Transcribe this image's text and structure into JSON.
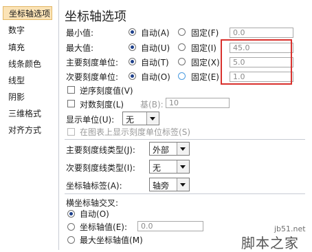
{
  "sidebar": {
    "items": [
      {
        "label": "坐标轴选项",
        "active": true
      },
      {
        "label": "数字"
      },
      {
        "label": "填充"
      },
      {
        "label": "线条颜色"
      },
      {
        "label": "线型"
      },
      {
        "label": "阴影"
      },
      {
        "label": "三维格式"
      },
      {
        "label": "对齐方式"
      }
    ]
  },
  "panel": {
    "title": "坐标轴选项",
    "auto_label": "自动",
    "fixed_label": "固定",
    "rows": [
      {
        "label": "最小值:",
        "auto_key": "A",
        "fixed_key": "F",
        "value": "0.0"
      },
      {
        "label": "最大值:",
        "auto_key": "U",
        "fixed_key": "I",
        "value": "45.0"
      },
      {
        "label": "主要刻度单位:",
        "auto_key": "T",
        "fixed_key": "X",
        "value": "5.0"
      },
      {
        "label": "次要刻度单位:",
        "auto_key": "O",
        "fixed_key": "E",
        "value": "1.0"
      }
    ],
    "reverse_order": "逆序刻度值",
    "reverse_key": "V",
    "log_scale": "对数刻度",
    "log_key": "L",
    "base_label": "基",
    "base_key": "B",
    "base_value": "10",
    "display_units_label": "显示单位",
    "display_units_key": "U",
    "display_units_value": "无",
    "show_units_label": "在图表上显示刻度单位标签",
    "show_units_key": "S",
    "major_tick_label": "主要刻度线类型",
    "major_tick_key": "J",
    "major_tick_value": "外部",
    "minor_tick_label": "次要刻度线类型",
    "minor_tick_key": "I",
    "minor_tick_value": "无",
    "axis_labels_label": "坐标轴标签",
    "axis_labels_key": "A",
    "axis_labels_value": "轴旁",
    "crosses_title": "横坐标轴交叉:",
    "crosses_auto": "自动",
    "crosses_auto_key": "O",
    "crosses_value_label": "坐标轴值",
    "crosses_value_key": "E",
    "crosses_value": "0.0",
    "crosses_max": "最大坐标轴值",
    "crosses_max_key": "M"
  },
  "watermark": {
    "site": "jb51.net",
    "brand": "脚本之家"
  },
  "colors": {
    "highlight_box": "#d9302c",
    "active_tab": "#fbe3b6"
  }
}
